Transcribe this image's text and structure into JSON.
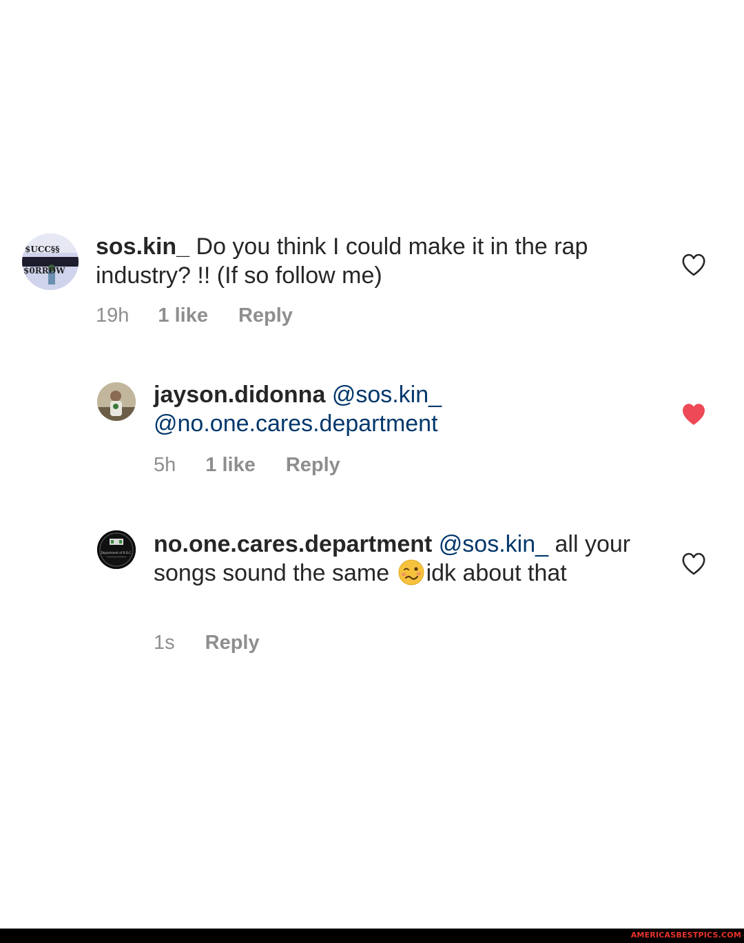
{
  "comments": [
    {
      "username": "sos.kin_",
      "text": " Do you think I could make it in the rap industry? !! (If so follow me)",
      "time": "19h",
      "likes": "1 like",
      "reply": "Reply",
      "liked": false,
      "avatar_text_top": "$UCC§§",
      "avatar_text_bottom": "$0RRØW"
    },
    {
      "username": "jayson.didonna",
      "mention_1": "@sos.kin_",
      "mention_2": "@no.one.cares.department",
      "time": "5h",
      "likes": "1 like",
      "reply": "Reply",
      "liked": true
    },
    {
      "username": "no.one.cares.department",
      "mention_1": "@sos.kin_",
      "text_before_emoji": " all your songs sound the same ",
      "emoji": "woozy-face-emoji",
      "text_after_emoji": "idk about that",
      "time": "1s",
      "reply": "Reply",
      "liked": false,
      "avatar_text": "Department of R.O.C."
    }
  ],
  "colors": {
    "text": "#262626",
    "mention": "#00376b",
    "meta": "#8e8e8e",
    "heart_filled": "#ed4956",
    "watermark": "#e8332a"
  },
  "watermark": "AMERICASBESTPICS.COM"
}
